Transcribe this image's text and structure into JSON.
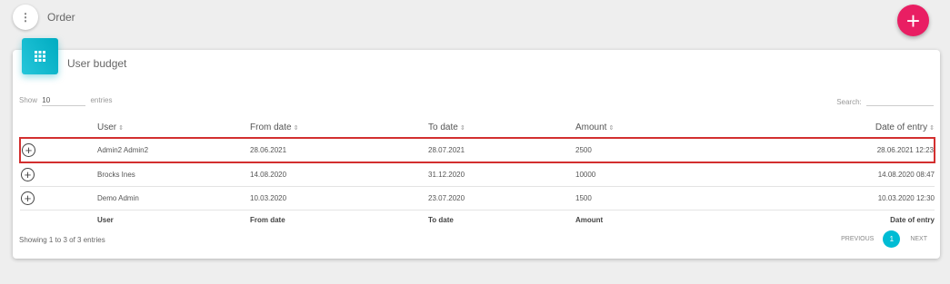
{
  "header": {
    "menu_icon": "dots-vertical-icon",
    "title": "Order",
    "add_icon": "plus-icon",
    "add_label": "+"
  },
  "card": {
    "icon": "grid-icon",
    "title": "User budget"
  },
  "controls": {
    "show_label": "Show",
    "page_size": "10",
    "entries_label": "entries",
    "search_label": "Search:",
    "search_value": ""
  },
  "table": {
    "columns": [
      "User",
      "From date",
      "To date",
      "Amount",
      "Date of entry"
    ],
    "sort_glyph": "⇕",
    "rows": [
      {
        "user": "Admin2 Admin2",
        "from": "28.06.2021",
        "to": "28.07.2021",
        "amount": "2500",
        "entry": "28.06.2021 12:23",
        "highlighted": true
      },
      {
        "user": "Brocks Ines",
        "from": "14.08.2020",
        "to": "31.12.2020",
        "amount": "10000",
        "entry": "14.08.2020 08:47",
        "highlighted": false
      },
      {
        "user": "Demo Admin",
        "from": "10.03.2020",
        "to": "23.07.2020",
        "amount": "1500",
        "entry": "10.03.2020 12:30",
        "highlighted": false
      }
    ],
    "footer": [
      "User",
      "From date",
      "To date",
      "Amount",
      "Date of entry"
    ],
    "expand_label": "+"
  },
  "footer": {
    "info": "Showing 1 to 3 of 3 entries",
    "previous": "PREVIOUS",
    "current_page": "1",
    "next": "NEXT"
  },
  "colors": {
    "accent": "#e91e63",
    "card_icon": "#00acc1",
    "highlight": "#d32f2f",
    "page_active": "#00bcd4"
  }
}
